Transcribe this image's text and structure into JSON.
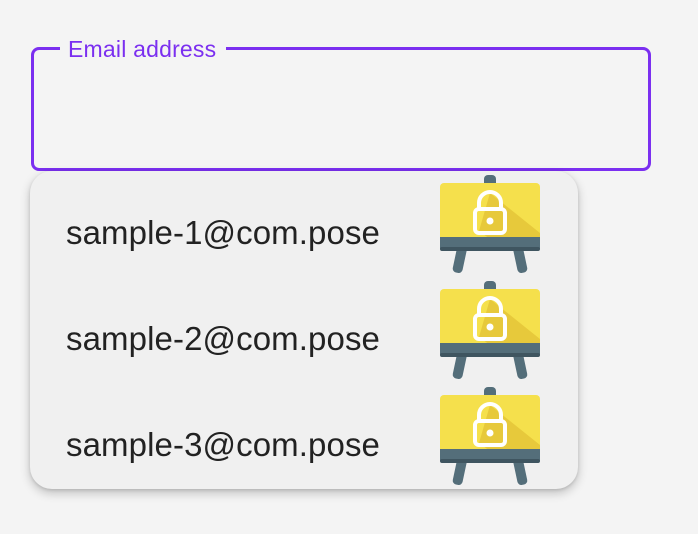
{
  "email_field": {
    "label": "Email address",
    "value": "",
    "placeholder": ""
  },
  "suggestions": [
    {
      "label": "sample-1@com.pose",
      "icon": "lock-easel-icon"
    },
    {
      "label": "sample-2@com.pose",
      "icon": "lock-easel-icon"
    },
    {
      "label": "sample-3@com.pose",
      "icon": "lock-easel-icon"
    }
  ],
  "colors": {
    "accent": "#7b2ff0",
    "background": "#f4f4f4",
    "dropdown": "#f0f0f0",
    "icon_yellow": "#f5e04c",
    "icon_shadow": "#e7c93b",
    "icon_base": "#546e7a",
    "text": "#222222"
  }
}
